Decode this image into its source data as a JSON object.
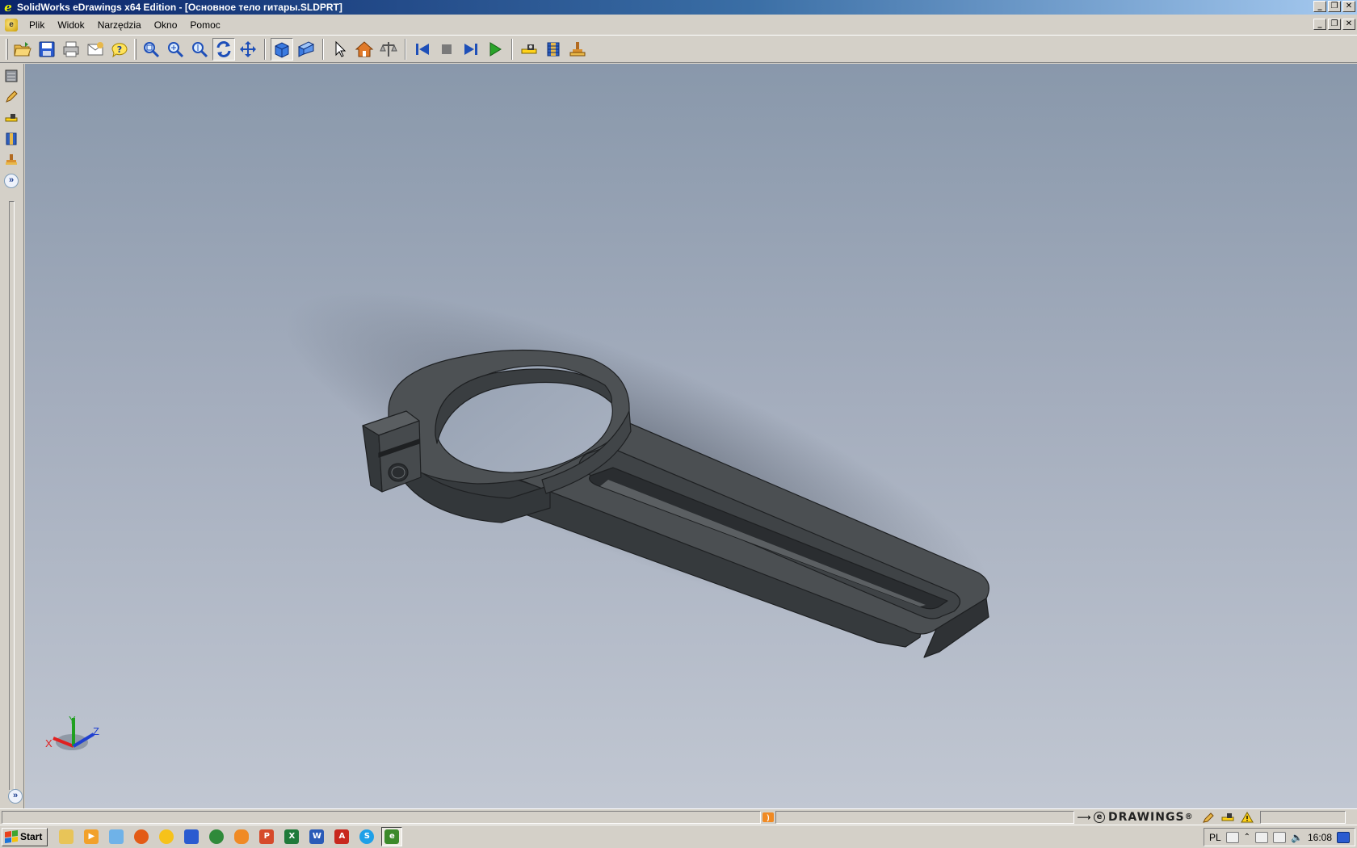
{
  "window": {
    "title": "SolidWorks eDrawings x64 Edition - [Основное тело гитары.SLDPRT]",
    "app_icon_letter": "e"
  },
  "menubar": {
    "items": [
      {
        "label": "Plik"
      },
      {
        "label": "Widok"
      },
      {
        "label": "Narzędzia"
      },
      {
        "label": "Okno"
      },
      {
        "label": "Pomoc"
      }
    ]
  },
  "toolbar": {
    "groups": [
      [
        "open-icon",
        "save-icon",
        "print-icon",
        "email-icon",
        "help-icon"
      ],
      [
        "zoom-fit-icon",
        "zoom-area-icon",
        "zoom-in-out-icon",
        "rotate-icon",
        "pan-icon"
      ],
      [
        "shaded-icon",
        "perspective-icon"
      ],
      [
        "select-icon",
        "home-icon",
        "measure-icon"
      ],
      [
        "first-frame-icon",
        "stop-icon",
        "next-frame-icon",
        "play-icon"
      ],
      [
        "measure-tool-icon",
        "section-icon",
        "stamp-icon"
      ]
    ],
    "pressed": [
      "rotate-icon",
      "shaded-icon"
    ]
  },
  "statusbar": {
    "brand": "DRAWINGS",
    "brand_mark": "®"
  },
  "taskbar": {
    "start_label": "Start",
    "language": "PL",
    "time": "16:08"
  },
  "colors": {
    "titlebar_start": "#0a246a",
    "viewport_top": "#8998ab",
    "viewport_bottom": "#c1c7d2",
    "model_body": "#4a4e51"
  }
}
